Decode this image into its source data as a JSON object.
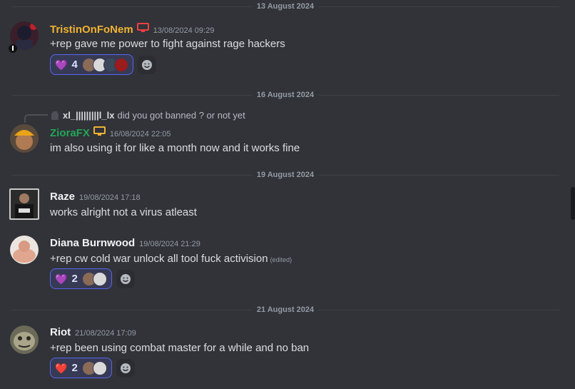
{
  "dividers": {
    "d1": "13 August 2024",
    "d2": "16 August 2024",
    "d3": "19 August 2024",
    "d4": "21 August 2024"
  },
  "colors": {
    "background": "#313338",
    "divider_line": "#3f4147",
    "reaction_border": "#5865f2",
    "name_tristin": "#f0b232",
    "name_ziora": "#23a559"
  },
  "messages": [
    {
      "author": "TristinOnFoNem",
      "author_color": "#f0b232",
      "badge_icon": "desktop-icon",
      "timestamp": "13/08/2024 09:29",
      "text": "+rep gave me power to fight against rage hackers",
      "reaction": {
        "emoji": "💜",
        "emoji_name": "purple-heart",
        "count": "4"
      }
    },
    {
      "author": "ZioraFX",
      "author_color": "#23a559",
      "badge_icon": "desktop-icon",
      "timestamp": "16/08/2024 22:05",
      "text": "im also using it for like a month now and it works fine",
      "reply": {
        "author": "xl_|||||||||l_lx",
        "text": "did you got banned ? or not yet"
      }
    },
    {
      "author": "Raze",
      "timestamp": "19/08/2024 17:18",
      "text": "works alright not a virus atleast"
    },
    {
      "author": "Diana Burnwood",
      "timestamp": "19/08/2024 21:29",
      "text": "+rep cw cold war unlock all tool fuck activision",
      "edited": "(edited)",
      "reaction": {
        "emoji": "💜",
        "emoji_name": "purple-heart",
        "count": "2"
      }
    },
    {
      "author": "Riot",
      "timestamp": "21/08/2024 17:09",
      "text": "+rep been using combat master for a while and no ban",
      "reaction": {
        "emoji": "❤️",
        "emoji_name": "red-heart",
        "count": "2"
      }
    }
  ]
}
